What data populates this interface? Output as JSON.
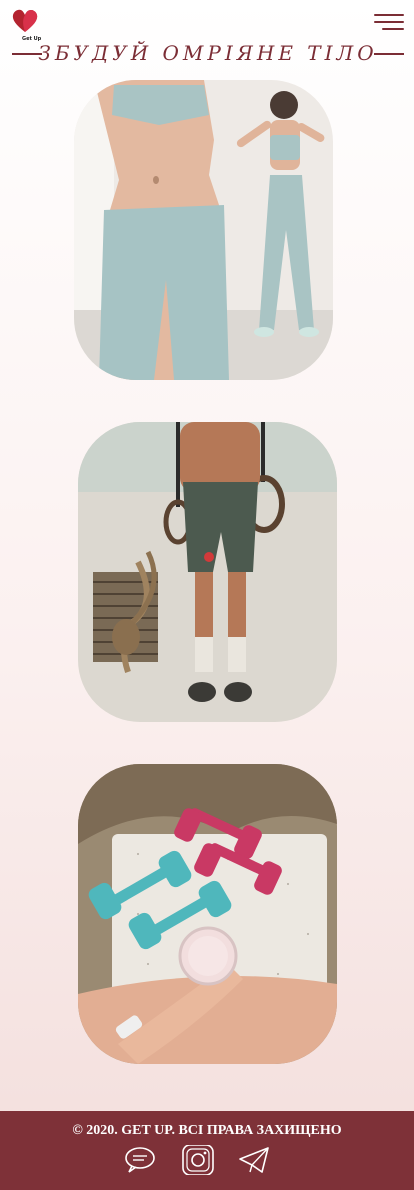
{
  "header": {
    "logo_text": "Get Up",
    "menu_icon": "hamburger-menu-icon"
  },
  "hero": {
    "title": "ЗБУДУЙ ОМРІЯНЕ ТІЛО"
  },
  "gallery": {
    "photos": [
      {
        "subject": "women-in-sportswear"
      },
      {
        "subject": "athlete-on-gym-rings"
      },
      {
        "subject": "pink-and-teal-dumbbells-with-shake"
      }
    ]
  },
  "footer": {
    "copyright": "© 2020. GET UP. ВСІ ПРАВА ЗАХИЩЕНО",
    "social": [
      "chat-bubble-icon",
      "instagram-icon",
      "telegram-icon"
    ]
  },
  "colors": {
    "brand": "#7e3138",
    "accent": "#7b2d35",
    "background_top": "#ffffff",
    "background_bottom": "#f3dedc"
  }
}
